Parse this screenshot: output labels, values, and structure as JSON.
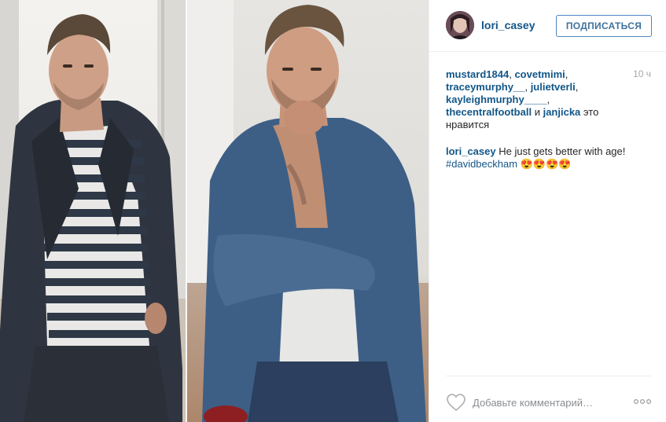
{
  "post": {
    "author": "lori_casey",
    "follow_label": "ПОДПИСАТЬСЯ",
    "time_ago": "10 ч",
    "likes": {
      "users": [
        "mustard1844",
        "covetmimi",
        "traceymurphy__",
        "julietverli",
        "kayleighmurphy____",
        "thecentralfootball",
        "janjicka"
      ],
      "and_word": "и",
      "suffix": "это нравится"
    },
    "caption": {
      "author": "lori_casey",
      "text": "He just gets better with age!",
      "hashtag": "#davidbeckham",
      "emoji": "😍😍😍😍"
    },
    "comment_placeholder": "Добавьте комментарий…"
  },
  "icons": {
    "like": "heart-outline-icon",
    "more": "more-options-icon"
  },
  "colors": {
    "link": "#125688",
    "follow_border": "#4d85bd",
    "follow_text": "#3f729b",
    "muted": "#a5a7aa"
  }
}
